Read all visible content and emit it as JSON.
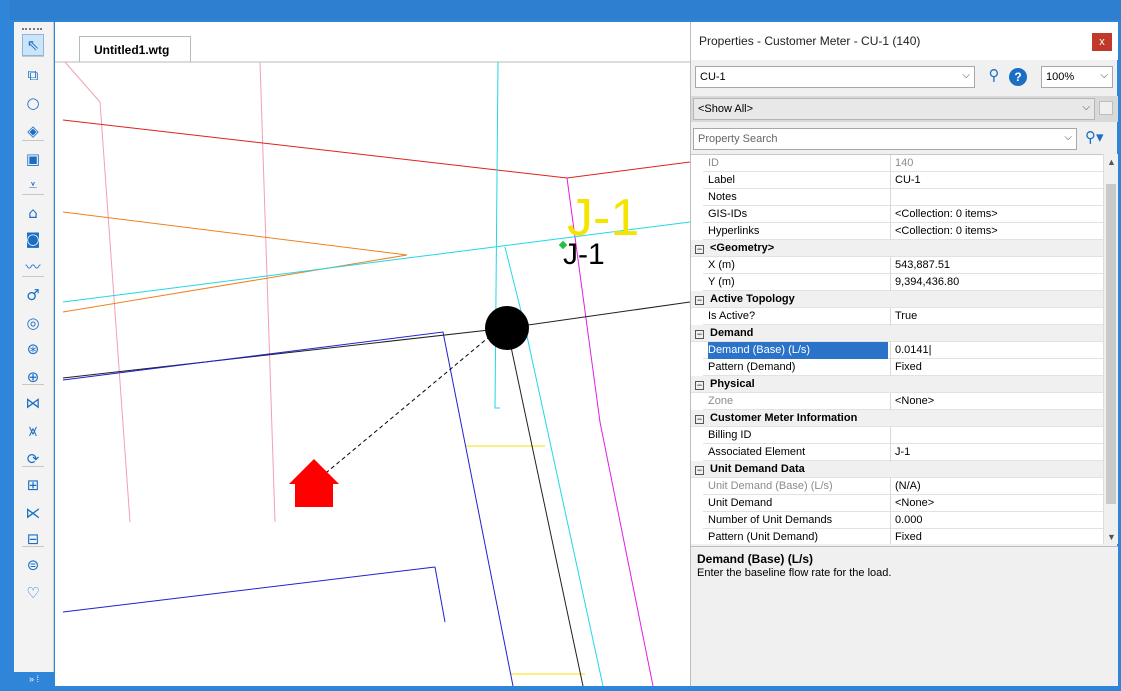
{
  "document_tab": {
    "label": "Untitled1.wtg"
  },
  "canvas": {
    "junction_label_large": "J-1",
    "junction_label_small": "J-1"
  },
  "toolbar": {
    "tools": [
      {
        "name": "select-icon",
        "glyph": "⇖"
      },
      {
        "name": "layout-icon",
        "glyph": "⧉"
      },
      {
        "name": "junction-icon",
        "glyph": "○"
      },
      {
        "name": "hydrant-icon",
        "glyph": "◈"
      },
      {
        "name": "tank-icon",
        "glyph": "▣"
      },
      {
        "name": "reservoir-icon",
        "glyph": "⩡"
      },
      {
        "name": "customer-meter-icon",
        "glyph": "⌂"
      },
      {
        "name": "pump-icon",
        "glyph": "◙"
      },
      {
        "name": "pipe-icon",
        "glyph": "〰"
      },
      {
        "name": "valve-icon",
        "glyph": "♂"
      },
      {
        "name": "prv-icon",
        "glyph": "◎"
      },
      {
        "name": "psv-icon",
        "glyph": "⊛"
      },
      {
        "name": "fcv-icon",
        "glyph": "⊕"
      },
      {
        "name": "isolation-valve-icon",
        "glyph": "⋈"
      },
      {
        "name": "gpv-icon",
        "glyph": "⩙"
      },
      {
        "name": "spot-elevation-icon",
        "glyph": "⟳"
      },
      {
        "name": "turbine-icon",
        "glyph": "⊞"
      },
      {
        "name": "check-valve-icon",
        "glyph": "⋉"
      },
      {
        "name": "air-valve-icon",
        "glyph": "⊟"
      },
      {
        "name": "surge-tank-icon",
        "glyph": "⊜"
      },
      {
        "name": "hydropneumatic-tank-icon",
        "glyph": "♡"
      }
    ],
    "scroll_label": "» ⁞"
  },
  "properties": {
    "title": "Properties - Customer Meter - CU-1 (140)",
    "close_label": "x",
    "element_selector": "CU-1",
    "zoom_value": "100%",
    "filter_value": "<Show All>",
    "search_placeholder": "Property Search",
    "rows": [
      {
        "type": "prop",
        "name": "ID",
        "value": "140",
        "disabled": true
      },
      {
        "type": "prop",
        "name": "Label",
        "value": "CU-1"
      },
      {
        "type": "prop",
        "name": "Notes",
        "value": ""
      },
      {
        "type": "prop",
        "name": "GIS-IDs",
        "value": "<Collection: 0 items>"
      },
      {
        "type": "prop",
        "name": "Hyperlinks",
        "value": "<Collection: 0 items>"
      },
      {
        "type": "section",
        "name": "<Geometry>"
      },
      {
        "type": "prop",
        "name": "X (m)",
        "value": "543,887.51"
      },
      {
        "type": "prop",
        "name": "Y (m)",
        "value": "9,394,436.80"
      },
      {
        "type": "section",
        "name": "Active Topology"
      },
      {
        "type": "prop",
        "name": "Is Active?",
        "value": "True"
      },
      {
        "type": "section",
        "name": "Demand"
      },
      {
        "type": "prop",
        "name": "Demand (Base) (L/s)",
        "value": "0.0141",
        "selected": true
      },
      {
        "type": "prop",
        "name": "Pattern (Demand)",
        "value": "Fixed"
      },
      {
        "type": "section",
        "name": "Physical"
      },
      {
        "type": "prop",
        "name": "Zone",
        "value": "<None>",
        "disabled": true,
        "value_enabled": true
      },
      {
        "type": "section",
        "name": "Customer Meter Information"
      },
      {
        "type": "prop",
        "name": "Billing ID",
        "value": ""
      },
      {
        "type": "prop",
        "name": "Associated Element",
        "value": "J-1"
      },
      {
        "type": "section",
        "name": "Unit Demand Data"
      },
      {
        "type": "prop",
        "name": "Unit Demand (Base) (L/s)",
        "value": "(N/A)",
        "disabled": true,
        "value_enabled": true
      },
      {
        "type": "prop",
        "name": "Unit Demand",
        "value": "<None>"
      },
      {
        "type": "prop",
        "name": "Number of Unit Demands",
        "value": "0.000"
      },
      {
        "type": "prop",
        "name": "Pattern (Unit Demand)",
        "value": "Fixed"
      }
    ],
    "description": {
      "title": "Demand (Base) (L/s)",
      "text": "Enter the baseline flow rate for the load."
    }
  },
  "colors": {
    "accent": "#2a73c9",
    "window_frame": "#2f86d8",
    "junction_label": "#f5e400",
    "customer_meter": "#ff0000"
  }
}
